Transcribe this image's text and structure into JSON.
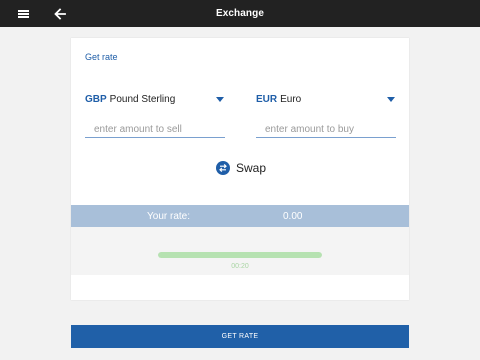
{
  "appbar": {
    "title": "Exchange",
    "menu_icon": "hamburger-menu-icon",
    "back_icon": "arrow-left-icon"
  },
  "card": {
    "get_rate_link": "Get rate",
    "sell": {
      "currency_code": "GBP",
      "currency_name": "Pound Sterling",
      "amount_value": "",
      "amount_placeholder": "enter amount to sell"
    },
    "buy": {
      "currency_code": "EUR",
      "currency_name": "Euro",
      "amount_value": "",
      "amount_placeholder": "enter amount to buy"
    },
    "swap_label": "Swap",
    "swap_icon": "swap-arrows-icon",
    "rate_label": "Your rate:",
    "rate_value": "0.00",
    "timer": "00:20",
    "progress_fraction": 1.0
  },
  "footer": {
    "get_rate_button": "GET RATE"
  },
  "colors": {
    "appbar": "#222222",
    "accent": "#1f5ea8",
    "button": "#2060a8",
    "rate_bar": "#a8bfd9",
    "progress": "#b6e2b1"
  }
}
